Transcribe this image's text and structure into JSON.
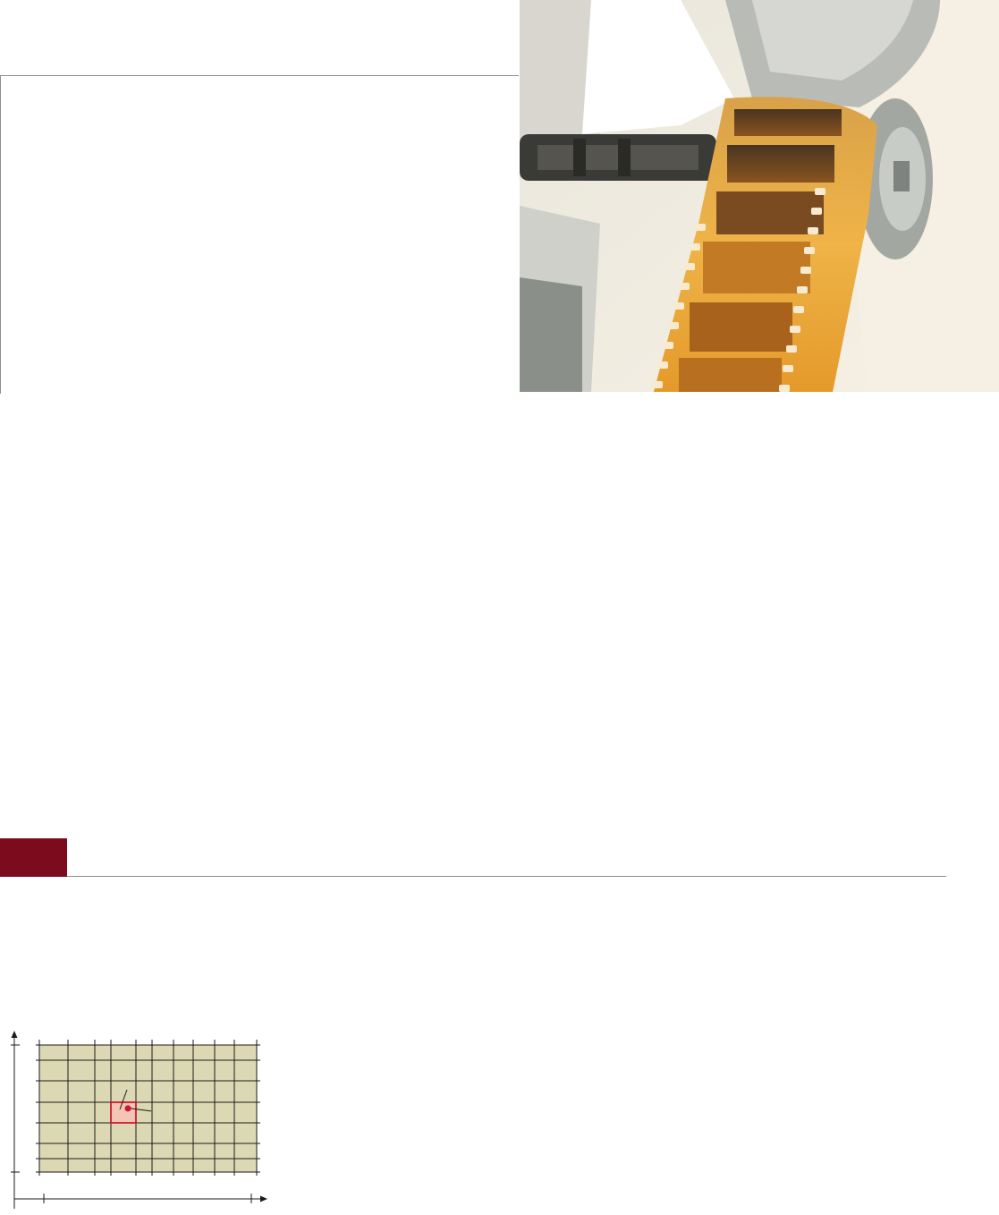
{
  "page": {
    "accent_color": "#7b0b1d",
    "rule_color": "#8c8c8c"
  },
  "photo": {
    "subject": "film-reel-on-projector",
    "film_color": "#e8a030"
  },
  "section": {
    "badge_color": "#7b0b1d"
  },
  "figure": {
    "grid_fill": "#ddd8b4",
    "grid_line_color": "#1a1a1a",
    "highlight_fill": "#f4c4b4",
    "highlight_stroke": "#d0152e",
    "point_color": "#d0152e",
    "columns": 10,
    "rows": 6,
    "highlight_cell": {
      "column": 4,
      "row": 3
    }
  }
}
